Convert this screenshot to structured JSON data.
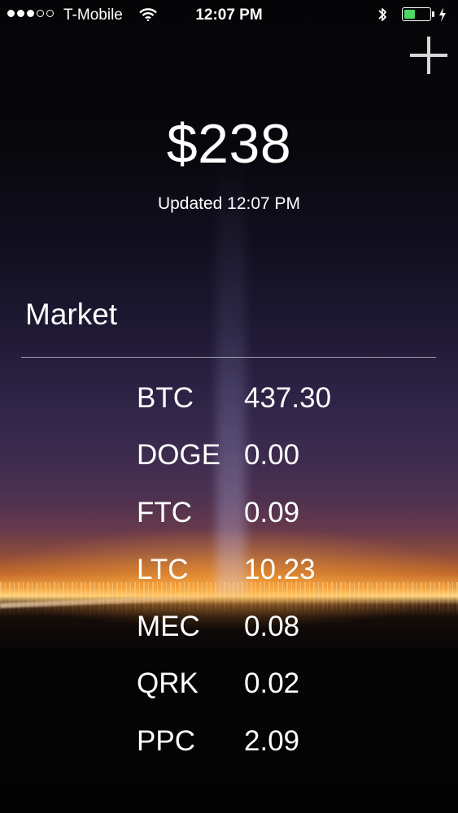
{
  "status_bar": {
    "signal_dots_filled": 3,
    "signal_dots_total": 5,
    "carrier": "T-Mobile",
    "time": "12:07 PM",
    "battery_level": 0.45,
    "battery_color": "#4cd964"
  },
  "icons": {
    "add": "plus-icon",
    "wifi": "wifi-icon",
    "bluetooth": "bluetooth-icon",
    "charging": "lightning-bolt-icon"
  },
  "portfolio": {
    "balance": "$238",
    "updated": "Updated 12:07 PM"
  },
  "market": {
    "title": "Market",
    "rows": [
      {
        "symbol": "BTC",
        "price": "437.30"
      },
      {
        "symbol": "DOGE",
        "price": "0.00"
      },
      {
        "symbol": "FTC",
        "price": "0.09"
      },
      {
        "symbol": "LTC",
        "price": "10.23"
      },
      {
        "symbol": "MEC",
        "price": "0.08"
      },
      {
        "symbol": "QRK",
        "price": "0.02"
      },
      {
        "symbol": "PPC",
        "price": "2.09"
      }
    ]
  }
}
